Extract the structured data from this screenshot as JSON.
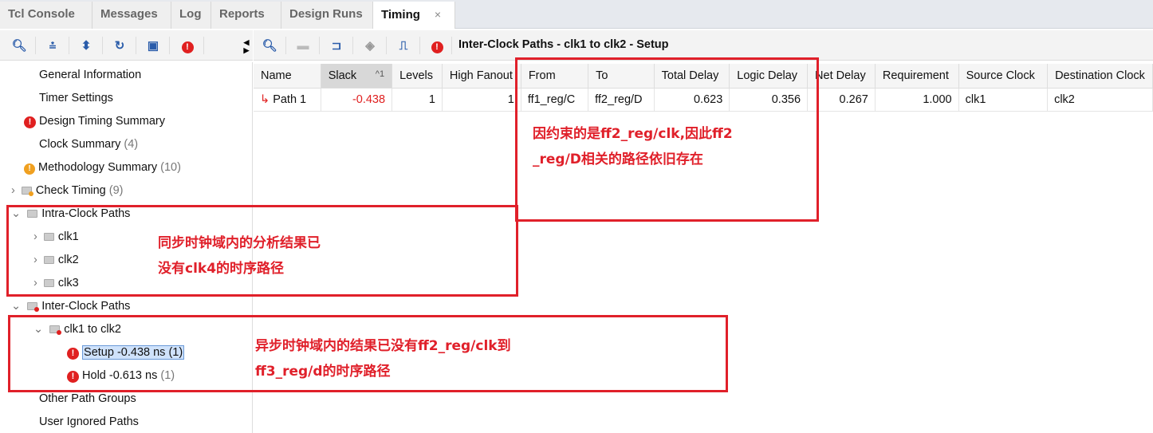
{
  "tabs": [
    {
      "label": "Tcl Console"
    },
    {
      "label": "Messages"
    },
    {
      "label": "Log"
    },
    {
      "label": "Reports"
    },
    {
      "label": "Design Runs"
    },
    {
      "label": "Timing",
      "active": true,
      "close": "×"
    }
  ],
  "view_title": "Inter-Clock Paths - clk1 to clk2 - Setup",
  "tree": {
    "general": "General Information",
    "timer": "Timer Settings",
    "dts": "Design Timing Summary",
    "clock_summary": "Clock Summary",
    "clock_summary_count": "(4)",
    "methodology": "Methodology Summary",
    "methodology_count": "(10)",
    "check_timing": "Check Timing",
    "check_timing_count": "(9)",
    "intra": "Intra-Clock Paths",
    "clk1": "clk1",
    "clk2": "clk2",
    "clk3": "clk3",
    "inter": "Inter-Clock Paths",
    "clk1_to_clk2": "clk1 to clk2",
    "setup": "Setup -0.438 ns (1)",
    "hold": "Hold -0.613 ns",
    "hold_count": "(1)",
    "other": "Other Path Groups",
    "ignored": "User Ignored Paths"
  },
  "table": {
    "columns": [
      "Name",
      "Slack",
      "Levels",
      "High Fanout",
      "From",
      "To",
      "Total Delay",
      "Logic Delay",
      "Net Delay",
      "Requirement",
      "Source Clock",
      "Destination Clock"
    ],
    "sort_indicator": "^1",
    "rows": [
      [
        "Path 1",
        "-0.438",
        "1",
        "1",
        "ff1_reg/C",
        "ff2_reg/D",
        "0.623",
        "0.356",
        "0.267",
        "1.000",
        "clk1",
        "clk2"
      ]
    ]
  },
  "annotations": {
    "a1": [
      "因约束的是ff2_reg/clk,因此ff2",
      "_reg/D相关的路径依旧存在"
    ],
    "a2": [
      "同步时钟域内的分析结果已",
      "没有clk4的时序路径"
    ],
    "a3": [
      "异步时钟域内的结果已没有ff2_reg/clk到",
      "ff3_reg/d的时序路径"
    ]
  },
  "colors": {
    "annotation": "#e0202a",
    "error": "#e02020",
    "selection": "#cfe2fb"
  }
}
